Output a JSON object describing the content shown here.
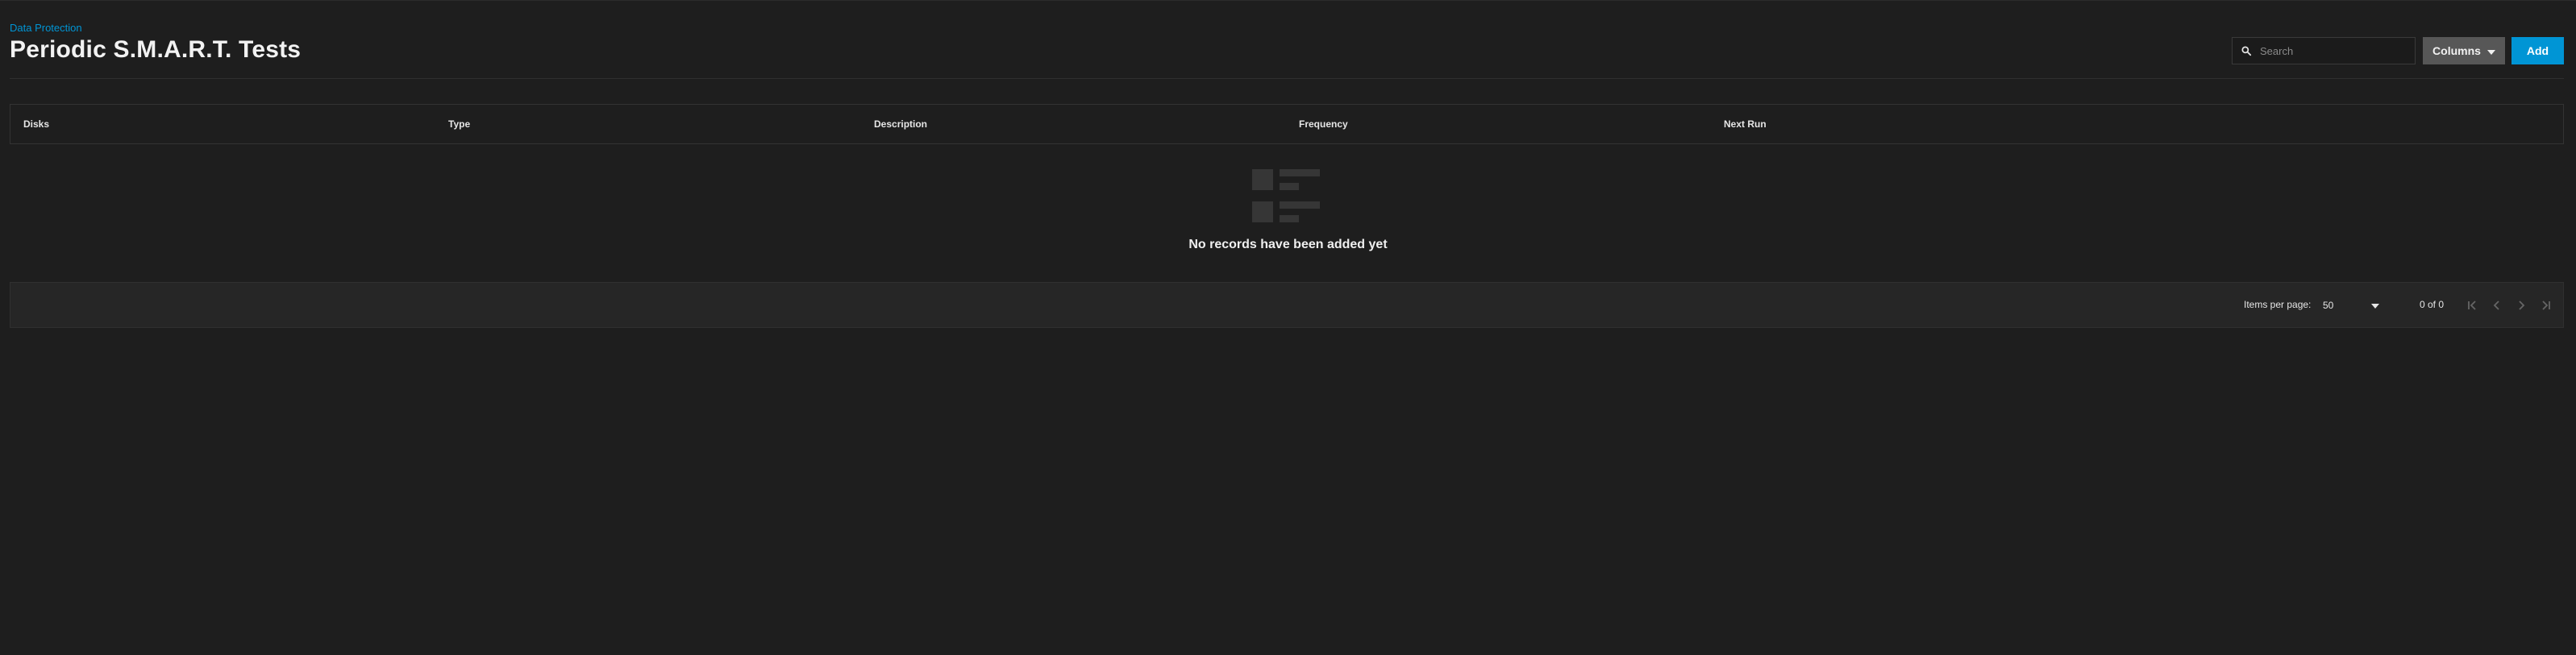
{
  "breadcrumb": {
    "label": "Data Protection"
  },
  "page": {
    "title": "Periodic S.M.A.R.T. Tests"
  },
  "toolbar": {
    "search_placeholder": "Search",
    "columns_label": "Columns",
    "add_label": "Add"
  },
  "table": {
    "columns": [
      "Disks",
      "Type",
      "Description",
      "Frequency",
      "Next Run"
    ],
    "empty_message": "No records have been added yet"
  },
  "paginator": {
    "items_per_page_label": "Items per page:",
    "items_per_page_value": "50",
    "range_label": "0 of 0"
  },
  "icons": {
    "search": "search-icon",
    "columns_dropdown": "caret-down-icon",
    "empty": "empty-list-icon",
    "first_page": "first-page-icon",
    "prev_page": "chevron-left-icon",
    "next_page": "chevron-right-icon",
    "last_page": "last-page-icon"
  },
  "colors": {
    "background": "#1e1e1e",
    "accent": "#0095d5",
    "columns_button": "#575757",
    "paginator_bg": "#262626"
  }
}
